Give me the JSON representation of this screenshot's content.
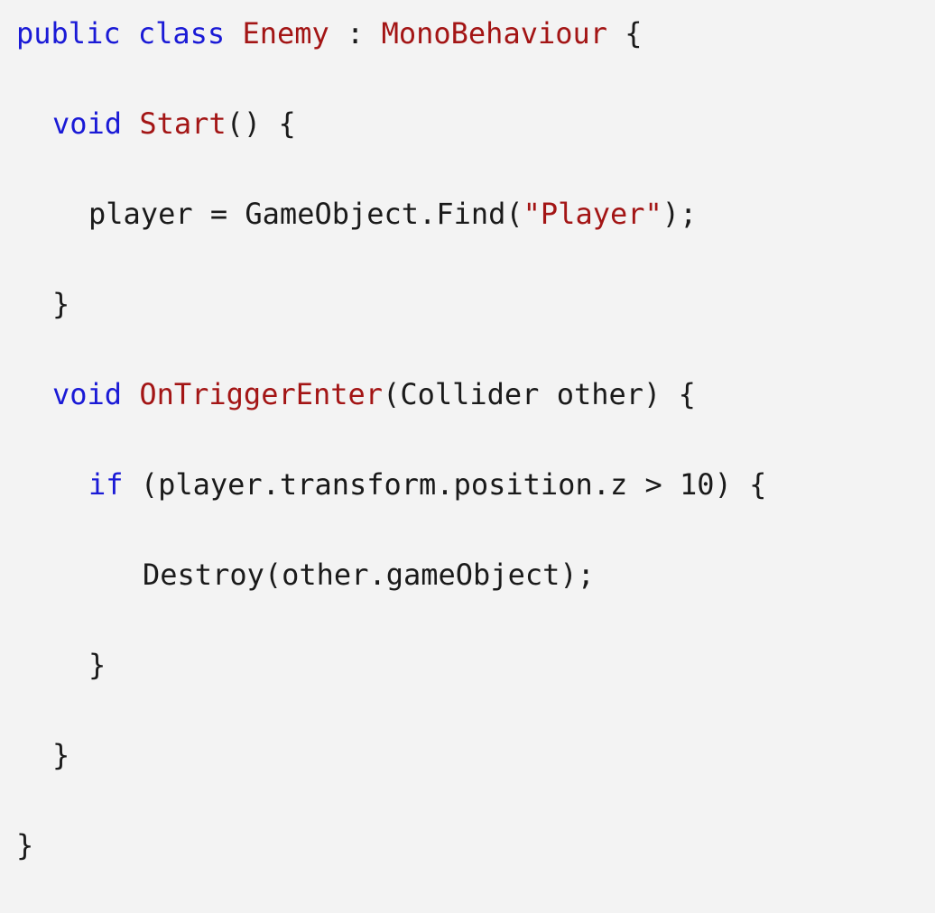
{
  "code": {
    "lines": [
      {
        "indent": 0,
        "tokens": [
          {
            "kind": "kw",
            "text": "public"
          },
          {
            "kind": "pl",
            "text": " "
          },
          {
            "kind": "kw",
            "text": "class"
          },
          {
            "kind": "pl",
            "text": " "
          },
          {
            "kind": "ty",
            "text": "Enemy"
          },
          {
            "kind": "pl",
            "text": " : "
          },
          {
            "kind": "ty",
            "text": "MonoBehaviour"
          },
          {
            "kind": "pl",
            "text": " {"
          }
        ]
      },
      {
        "indent": 1,
        "tokens": [
          {
            "kind": "kw",
            "text": "void"
          },
          {
            "kind": "pl",
            "text": " "
          },
          {
            "kind": "ty",
            "text": "Start"
          },
          {
            "kind": "pl",
            "text": "() {"
          }
        ]
      },
      {
        "indent": 2,
        "tokens": [
          {
            "kind": "pl",
            "text": "player = GameObject.Find("
          },
          {
            "kind": "st",
            "text": "\"Player\""
          },
          {
            "kind": "pl",
            "text": ");"
          }
        ]
      },
      {
        "indent": 1,
        "tokens": [
          {
            "kind": "pl",
            "text": "}"
          }
        ]
      },
      {
        "indent": 1,
        "tokens": [
          {
            "kind": "kw",
            "text": "void"
          },
          {
            "kind": "pl",
            "text": " "
          },
          {
            "kind": "ty",
            "text": "OnTriggerEnter"
          },
          {
            "kind": "pl",
            "text": "(Collider other) {"
          }
        ]
      },
      {
        "indent": 2,
        "tokens": [
          {
            "kind": "kw",
            "text": "if"
          },
          {
            "kind": "pl",
            "text": " (player.transform.position.z > 10) {"
          }
        ]
      },
      {
        "indent": 3,
        "tokens": [
          {
            "kind": "pl",
            "text": "Destroy(other.gameObject);"
          }
        ]
      },
      {
        "indent": 2,
        "tokens": [
          {
            "kind": "pl",
            "text": "}"
          }
        ]
      },
      {
        "indent": 1,
        "tokens": [
          {
            "kind": "pl",
            "text": "}"
          }
        ]
      },
      {
        "indent": 0,
        "tokens": [
          {
            "kind": "pl",
            "text": "}"
          }
        ]
      }
    ]
  },
  "colors": {
    "background": "#f3f3f3",
    "keyword": "#1a1ad6",
    "type": "#a31515",
    "string": "#a31515",
    "plain": "#1a1a1a"
  }
}
